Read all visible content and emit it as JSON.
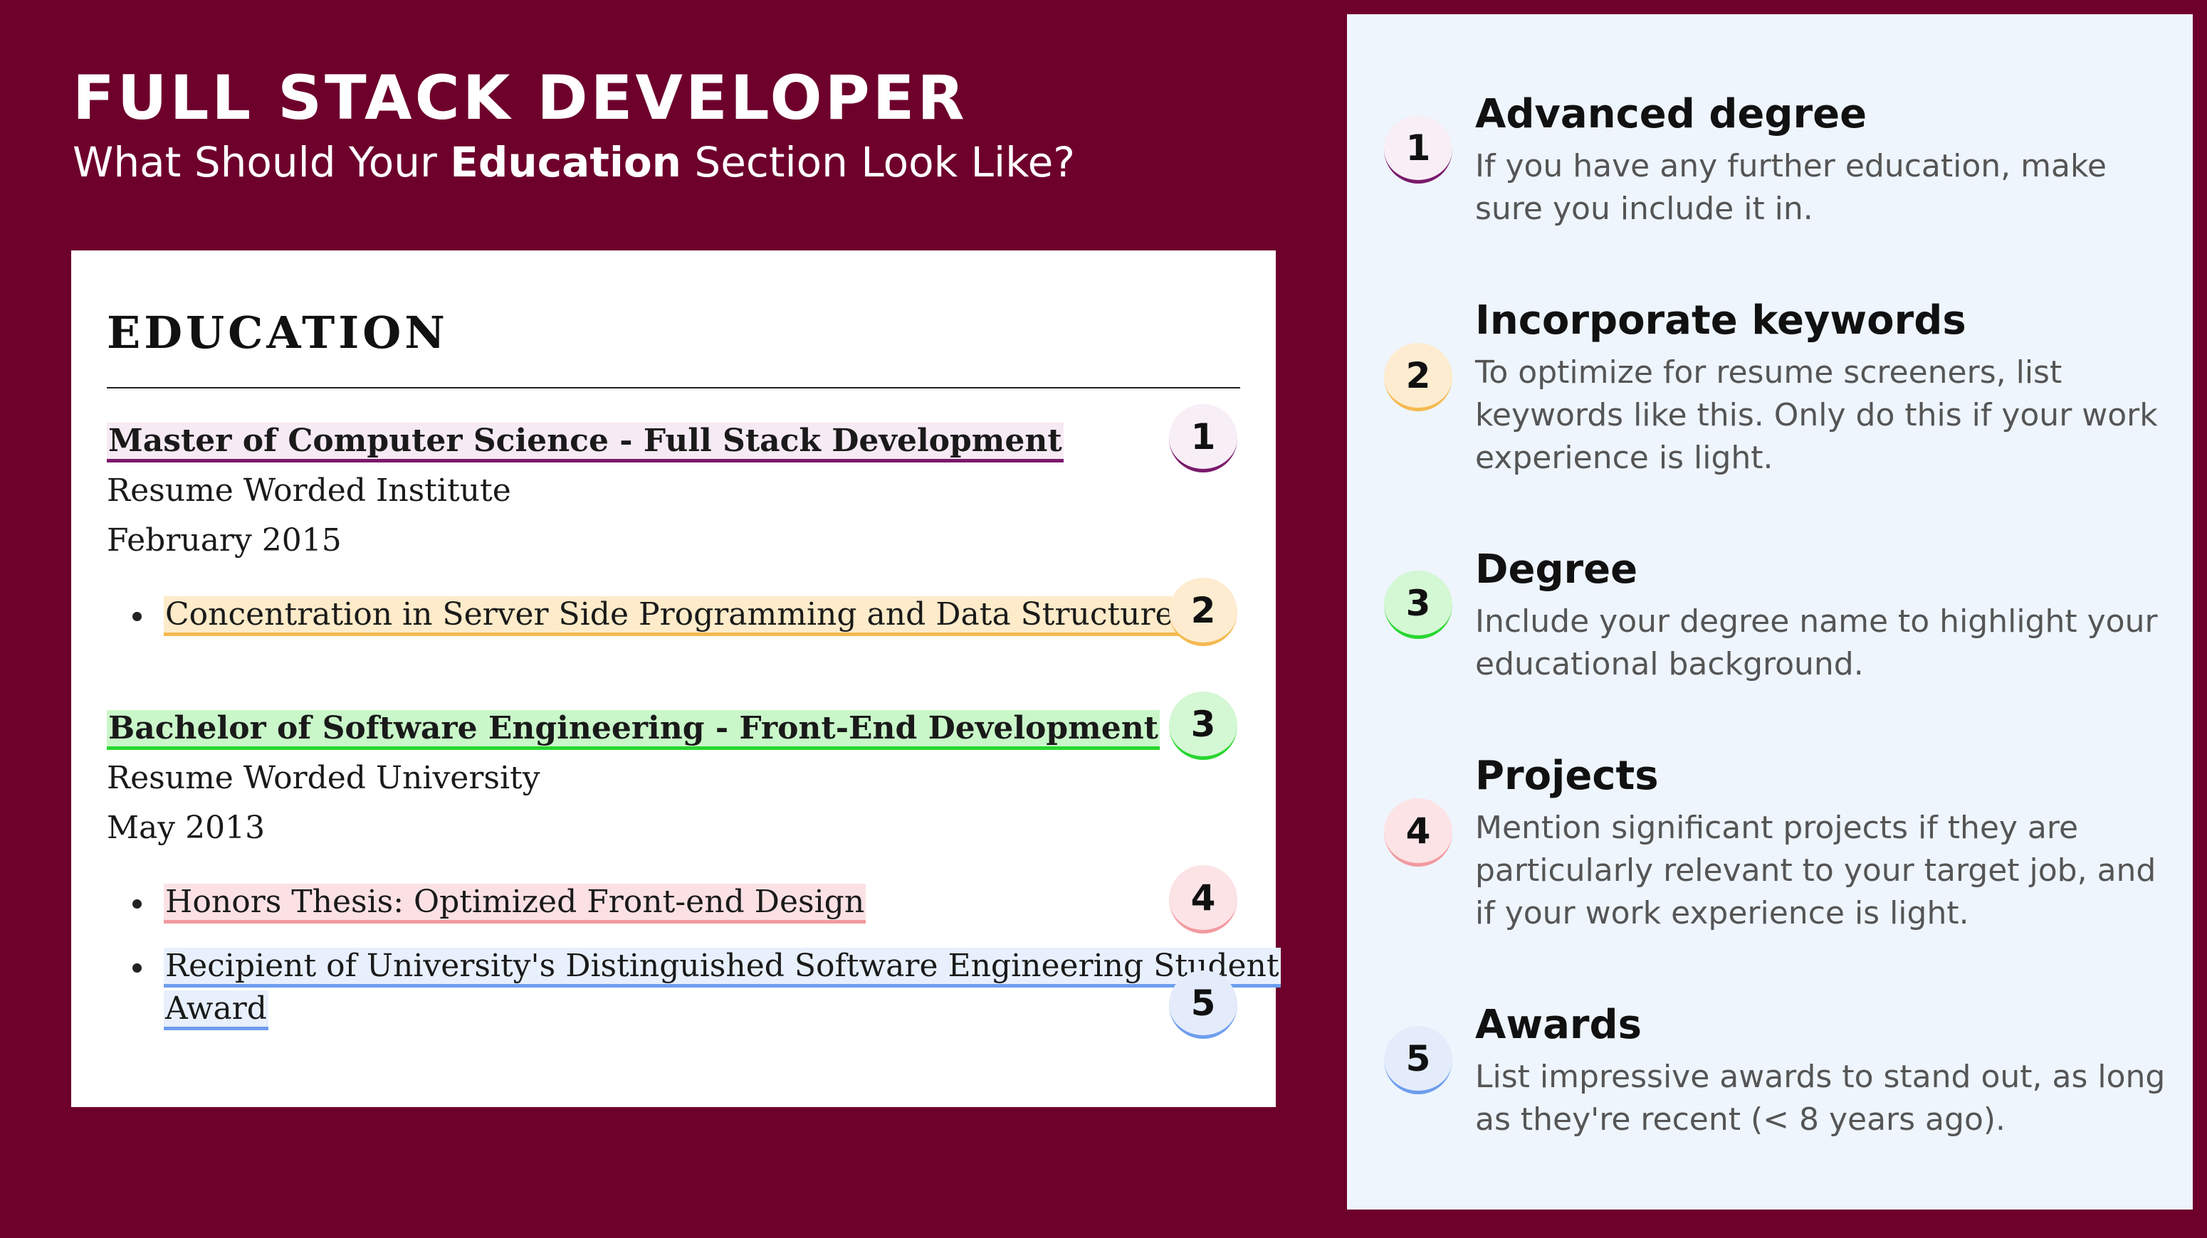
{
  "header": {
    "title": "FULL STACK DEVELOPER",
    "subtitle_pre": "What Should Your ",
    "subtitle_bold": "Education",
    "subtitle_post": " Section Look Like?"
  },
  "resume": {
    "heading": "EDUCATION",
    "degree1": {
      "title": "Master of Computer Science - Full Stack Development",
      "school": "Resume Worded Institute",
      "date": "February 2015",
      "bullet": "Concentration in Server Side Programming and Data Structures"
    },
    "degree2": {
      "title": "Bachelor of Software Engineering - Front-End Development",
      "school": "Resume Worded University",
      "date": "May 2013",
      "bullet1": "Honors Thesis: Optimized Front-end Design",
      "bullet2_line1": "Recipient of University's Distinguished Software Engineering Student",
      "bullet2_line2": "Award"
    },
    "badges": [
      "1",
      "2",
      "3",
      "4",
      "5"
    ]
  },
  "tips": [
    {
      "number": "1",
      "title": "Advanced degree",
      "description": "If you have any further education, make sure you include it in.",
      "color": "#7a1a6b"
    },
    {
      "number": "2",
      "title": "Incorporate keywords",
      "description": "To optimize for resume screeners, list keywords like this. Only do this if your work experience is light.",
      "color": "#f5b94f"
    },
    {
      "number": "3",
      "title": "Degree",
      "description": "Include your degree name to highlight your educational background.",
      "color": "#27d62f"
    },
    {
      "number": "4",
      "title": "Projects",
      "description": "Mention significant projects if they are particularly relevant to your target job, and if your work experience is light.",
      "color": "#f29aa0"
    },
    {
      "number": "5",
      "title": "Awards",
      "description": "List impressive awards to stand out, as long as they're recent (< 8 years ago).",
      "color": "#6d9eee"
    }
  ],
  "colors": {
    "background": "#6e002c",
    "panel": "#eef5fd",
    "card": "#ffffff"
  }
}
